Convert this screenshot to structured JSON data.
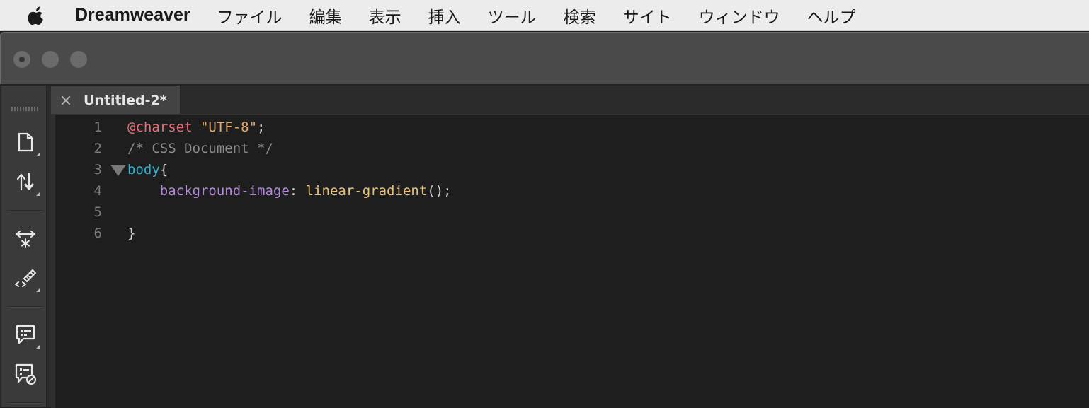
{
  "menubar": {
    "app_name": "Dreamweaver",
    "items": [
      "ファイル",
      "編集",
      "表示",
      "挿入",
      "ツール",
      "検索",
      "サイト",
      "ウィンドウ",
      "ヘルプ"
    ]
  },
  "window": {
    "tab": {
      "title": "Untitled-2*"
    }
  },
  "toolbar": {
    "buttons": [
      "document-icon",
      "file-transfer-icon",
      "expand-collapse-icon",
      "code-format-icon",
      "comment-icon",
      "remove-comment-icon"
    ]
  },
  "editor": {
    "lines": [
      {
        "number": "1",
        "tokens": [
          {
            "t": "@charset",
            "k": "at"
          },
          {
            "t": " ",
            "k": "punc"
          },
          {
            "t": "\"UTF-8\"",
            "k": "str"
          },
          {
            "t": ";",
            "k": "punc"
          }
        ]
      },
      {
        "number": "2",
        "tokens": [
          {
            "t": "/* CSS Document */",
            "k": "comment"
          }
        ]
      },
      {
        "number": "3",
        "fold": true,
        "tokens": [
          {
            "t": "body",
            "k": "sel"
          },
          {
            "t": "{",
            "k": "punc"
          }
        ]
      },
      {
        "number": "4",
        "tokens": [
          {
            "t": "    background-image",
            "k": "prop"
          },
          {
            "t": ": ",
            "k": "punc"
          },
          {
            "t": "linear-gradient",
            "k": "func"
          },
          {
            "t": "();",
            "k": "punc"
          }
        ]
      },
      {
        "number": "5",
        "tokens": []
      },
      {
        "number": "6",
        "tokens": [
          {
            "t": "}",
            "k": "punc"
          }
        ]
      }
    ]
  },
  "colors": {
    "at_rule": "#e0707a",
    "string": "#e8a866",
    "comment": "#8c8c8c",
    "selector": "#33b3d6",
    "property": "#b28ad8",
    "function": "#e8c17a"
  }
}
